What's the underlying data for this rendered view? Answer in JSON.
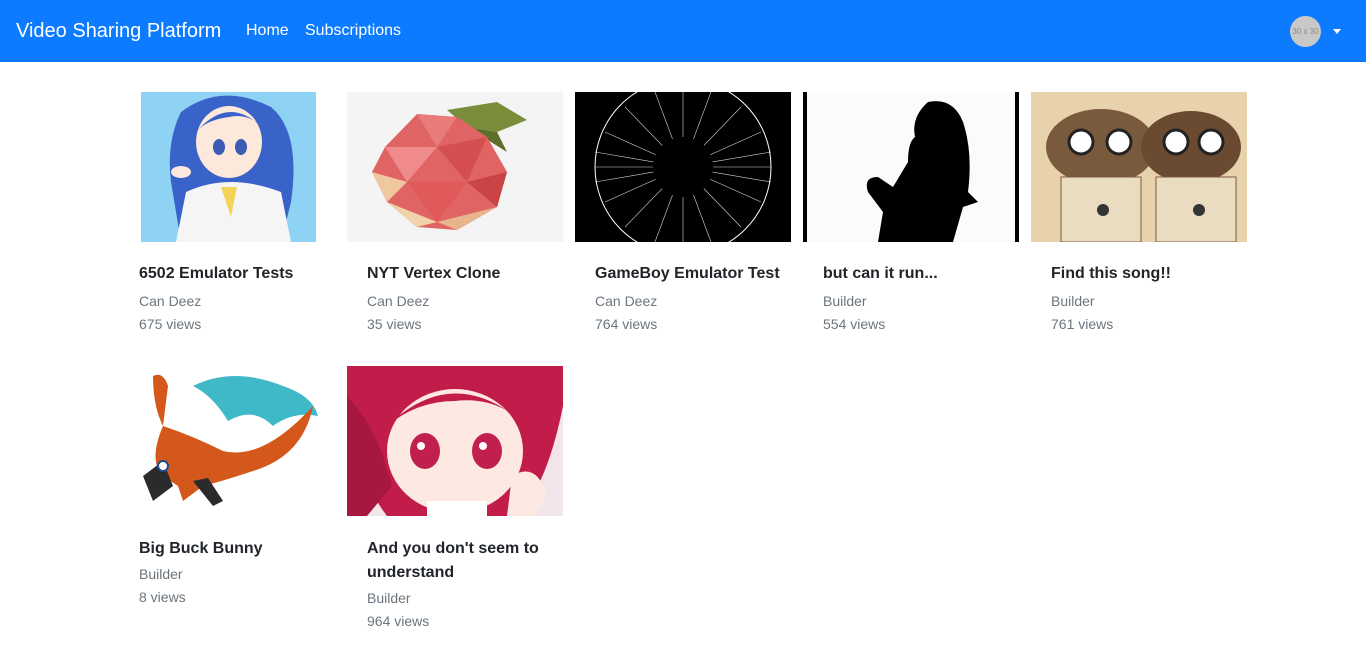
{
  "nav": {
    "brand": "Video Sharing Platform",
    "links": [
      "Home",
      "Subscriptions"
    ],
    "avatar_text": "30 x 30"
  },
  "colors": {
    "navbar": "#0d7bff"
  },
  "videos": [
    {
      "title": "6502 Emulator Tests",
      "channel": "Can Deez",
      "views": "675 views",
      "thumb": "anime-girl-blue-hair"
    },
    {
      "title": "NYT Vertex Clone",
      "channel": "Can Deez",
      "views": "35 views",
      "thumb": "low-poly-apple"
    },
    {
      "title": "GameBoy Emulator Test",
      "channel": "Can Deez",
      "views": "764 views",
      "thumb": "string-art-circle"
    },
    {
      "title": "but can it run...",
      "channel": "Builder",
      "views": "554 views",
      "thumb": "silhouette"
    },
    {
      "title": "Find this song!!",
      "channel": "Builder",
      "views": "761 views",
      "thumb": "vintage-cartoon"
    },
    {
      "title": "Big Buck Bunny",
      "channel": "Builder",
      "views": "8 views",
      "thumb": "pixel-dragon"
    },
    {
      "title": "And you don't seem to understand",
      "channel": "Builder",
      "views": "964 views",
      "thumb": "anime-girl-red-hair"
    }
  ]
}
